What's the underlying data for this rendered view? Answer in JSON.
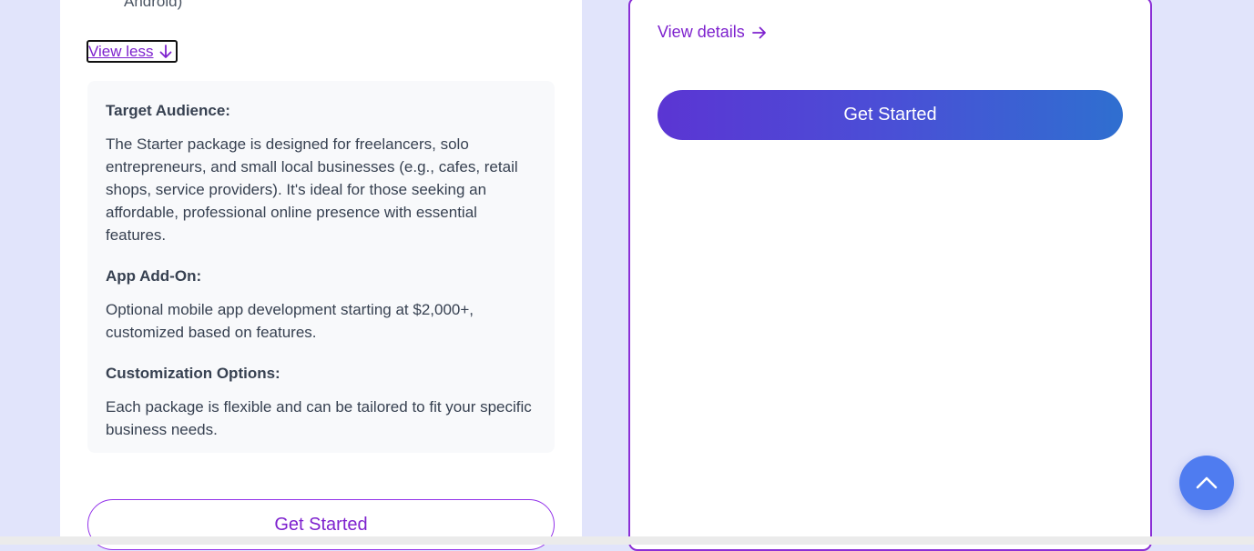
{
  "left_card": {
    "truncated_feature": "Android)",
    "view_less_label": "View less",
    "sections": [
      {
        "heading": "Target Audience:",
        "body": "The Starter package is designed for freelancers, solo entrepreneurs, and small local businesses (e.g., cafes, retail shops, service providers). It's ideal for those seeking an affordable, professional online presence with essential features."
      },
      {
        "heading": "App Add-On:",
        "body": "Optional mobile app development starting at $2,000+, customized based on features."
      },
      {
        "heading": "Customization Options:",
        "body": "Each package is flexible and can be tailored to fit your specific business needs."
      }
    ],
    "cta_label": "Get Started"
  },
  "right_card": {
    "view_details_label": "View details",
    "cta_label": "Get Started"
  },
  "icons": {
    "view_less": "arrow-down-icon",
    "view_details": "arrow-right-icon",
    "scroll_top": "chevron-up-icon"
  },
  "colors": {
    "page_background": "#e1e4fb",
    "accent_purple": "#7e22ce",
    "card_border": "#8b2fd6",
    "gradient_start": "#5b35d3",
    "gradient_end": "#2f6fd0",
    "scroll_button": "#4f7cf0"
  }
}
